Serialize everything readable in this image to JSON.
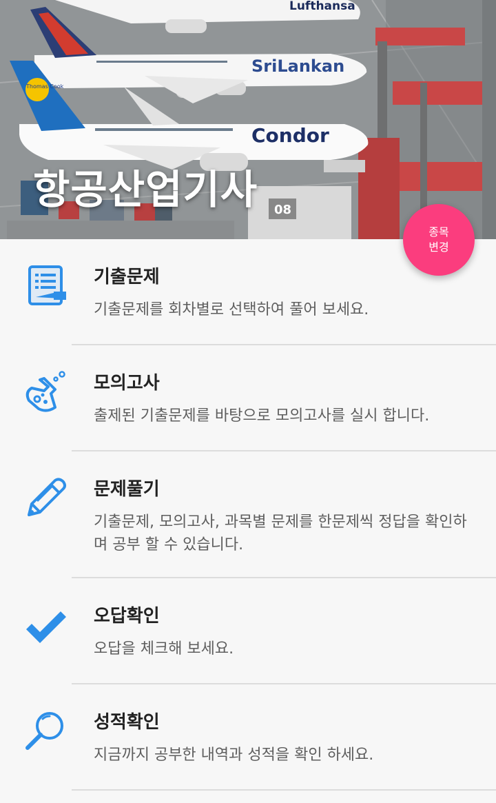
{
  "header": {
    "title": "항공산업기사",
    "image": "airport-apron-with-parked-airliners",
    "airline_liveries": [
      "Lufthansa",
      "SriLankan",
      "Condor",
      "Thomas Cook"
    ],
    "gate_number": "08"
  },
  "fab": {
    "line1": "종목",
    "line2": "변경",
    "color": "#fb3d7e"
  },
  "menu": {
    "items": [
      {
        "icon": "notebook-list-icon",
        "title": "기출문제",
        "desc": "기출문제를 회차별로 선택하여 풀어 보세요."
      },
      {
        "icon": "flask-icon",
        "title": "모의고사",
        "desc": "출제된 기출문제를 바탕으로 모의고사를 실시 합니다."
      },
      {
        "icon": "pencil-icon",
        "title": "문제풀기",
        "desc": "기출문제, 모의고사, 과목별 문제를 한문제씩 정답을 확인하며 공부 할 수 있습니다."
      },
      {
        "icon": "checkmark-icon",
        "title": "오답확인",
        "desc": "오답을 체크해 보세요."
      },
      {
        "icon": "magnifier-icon",
        "title": "성적확인",
        "desc": "지금까지 공부한 내역과 성적을 확인 하세요."
      }
    ]
  },
  "colors": {
    "icon_blue": "#2e8fe8",
    "background": "#f7f7f7",
    "divider": "#dcdcdc"
  }
}
